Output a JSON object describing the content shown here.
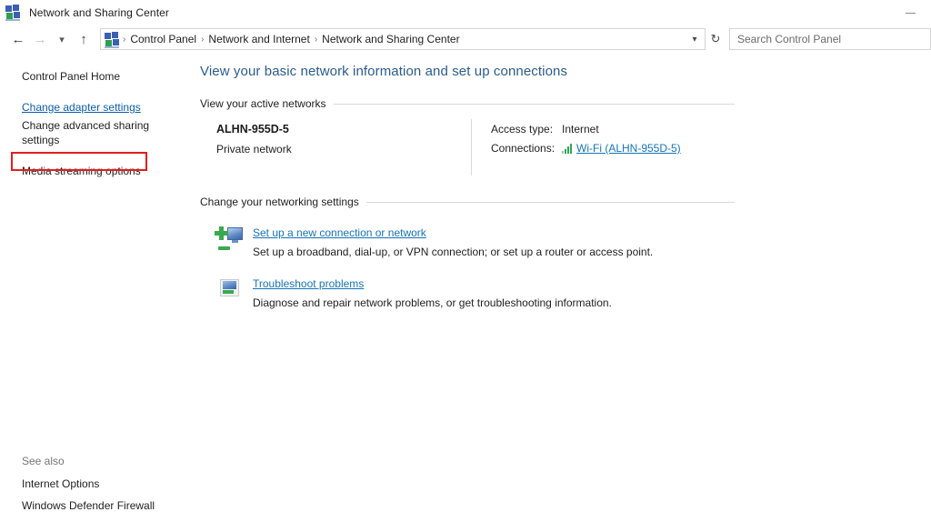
{
  "window": {
    "title": "Network and Sharing Center",
    "app_icon": "network-icon",
    "minimize_label": "Minimize"
  },
  "addressbar": {
    "back_icon": "back-arrow-icon",
    "forward_icon": "forward-arrow-icon",
    "recent_icon": "chevron-down-icon",
    "up_icon": "up-arrow-icon",
    "path_icon": "network-icon",
    "separator": "›",
    "crumbs": [
      "Control Panel",
      "Network and Internet",
      "Network and Sharing Center"
    ],
    "dropdown_icon": "chevron-down-icon",
    "refresh_icon": "refresh-icon",
    "refresh_glyph": "↻"
  },
  "search": {
    "placeholder": "Search Control Panel",
    "value": ""
  },
  "sidebar": {
    "home_label": "Control Panel Home",
    "items": [
      {
        "label": "Change adapter settings",
        "state": "hovered-highlighted"
      },
      {
        "label": "Change advanced sharing settings",
        "state": "normal"
      },
      {
        "label": "Media streaming options",
        "state": "normal"
      }
    ],
    "highlight_color": "#e0201b",
    "see_also": {
      "title": "See also",
      "items": [
        "Internet Options",
        "Windows Defender Firewall"
      ]
    }
  },
  "main": {
    "page_title": "View your basic network information and set up connections",
    "active_networks": {
      "section_label": "View your active networks",
      "network_name": "ALHN-955D-5",
      "network_type": "Private network",
      "access_type_label": "Access type:",
      "access_type_value": "Internet",
      "connections_label": "Connections:",
      "connections_value": "Wi-Fi (ALHN-955D-5)",
      "signal_icon": "wifi-signal-icon",
      "signal_bars": 4,
      "signal_color": "#2faa52"
    },
    "networking_settings": {
      "section_label": "Change your networking settings",
      "actions": [
        {
          "icon": "new-connection-icon",
          "title": "Set up a new connection or network",
          "description": "Set up a broadband, dial-up, or VPN connection; or set up a router or access point."
        },
        {
          "icon": "troubleshoot-icon",
          "title": "Troubleshoot problems",
          "description": "Diagnose and repair network problems, or get troubleshooting information."
        }
      ]
    }
  },
  "colors": {
    "link": "#1674b8",
    "title_blue": "#2c5c8f",
    "highlight_red": "#e0201b"
  }
}
